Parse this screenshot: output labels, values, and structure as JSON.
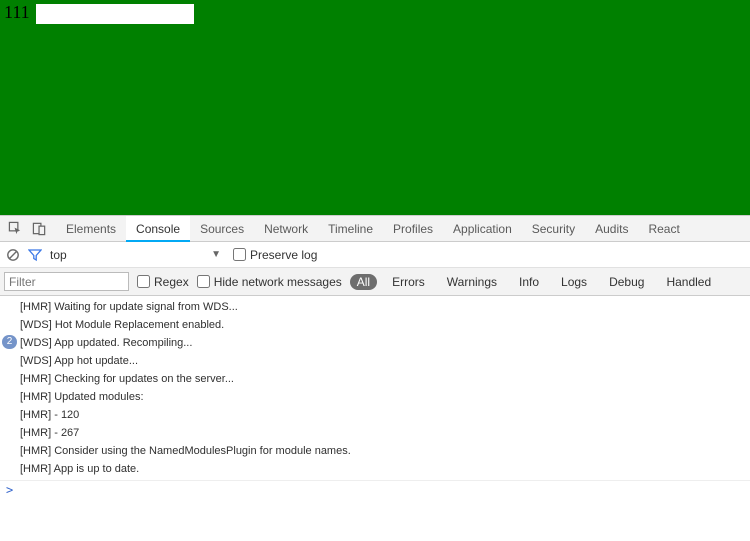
{
  "viewport": {
    "text": "111",
    "input_value": ""
  },
  "devtools": {
    "tabs": [
      "Elements",
      "Console",
      "Sources",
      "Network",
      "Timeline",
      "Profiles",
      "Application",
      "Security",
      "Audits",
      "React"
    ],
    "active_tab": "Console",
    "context_selector": "top",
    "preserve_log_label": "Preserve log",
    "filter_placeholder": "Filter",
    "regex_label": "Regex",
    "hide_network_label": "Hide network messages",
    "levels": [
      "All",
      "Errors",
      "Warnings",
      "Info",
      "Logs",
      "Debug",
      "Handled"
    ],
    "active_level": "All",
    "logs": [
      {
        "count": null,
        "text": "[HMR] Waiting for update signal from WDS..."
      },
      {
        "count": null,
        "text": "[WDS] Hot Module Replacement enabled."
      },
      {
        "count": 2,
        "text": "[WDS] App updated. Recompiling..."
      },
      {
        "count": null,
        "text": "[WDS] App hot update..."
      },
      {
        "count": null,
        "text": "[HMR] Checking for updates on the server..."
      },
      {
        "count": null,
        "text": "[HMR] Updated modules:"
      },
      {
        "count": null,
        "text": "[HMR]  - 120"
      },
      {
        "count": null,
        "text": "[HMR]  - 267"
      },
      {
        "count": null,
        "text": "[HMR] Consider using the NamedModulesPlugin for module names."
      },
      {
        "count": null,
        "text": "[HMR] App is up to date."
      }
    ],
    "prompt": ">"
  }
}
